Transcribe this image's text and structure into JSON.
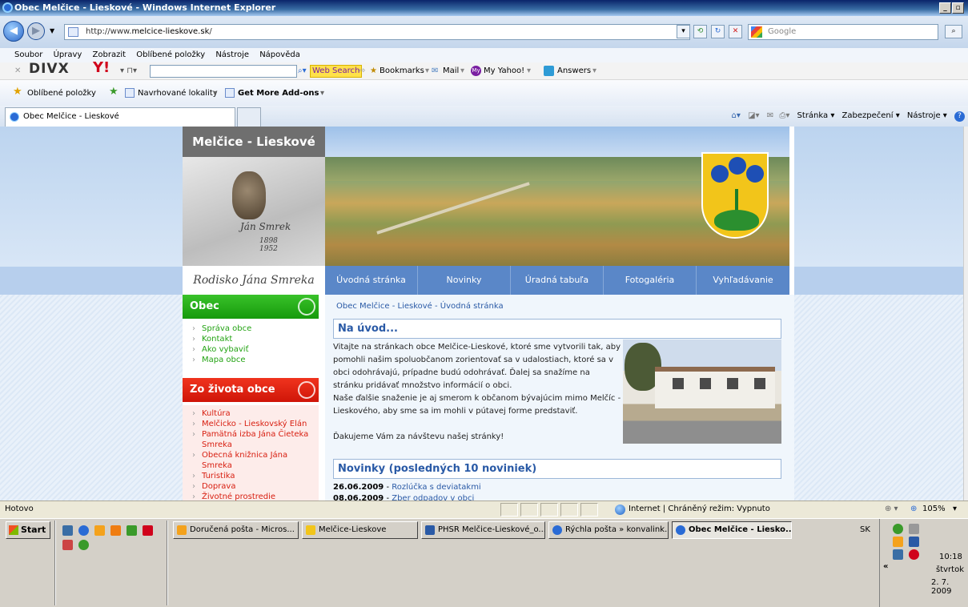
{
  "window": {
    "title": "Obec Melčice - Lieskové - Windows Internet Explorer"
  },
  "address": {
    "url_prefix": "http://www.",
    "url_domain": "melcice-lieskove.sk",
    "url_suffix": "/",
    "search_placeholder": "Google"
  },
  "menu": [
    "Soubor",
    "Úpravy",
    "Zobrazit",
    "Oblíbené položky",
    "Nástroje",
    "Nápověda"
  ],
  "toolbar1": {
    "divx": "DIVX",
    "web_search": "Web Search",
    "bookmarks": "Bookmarks",
    "mail": "Mail",
    "my_yahoo": "My Yahoo!",
    "answers": "Answers"
  },
  "toolbar2": {
    "favorites": "Oblíbené položky",
    "suggested": "Navrhované lokality",
    "addons": "Get More Add-ons"
  },
  "tab": {
    "label": "Obec Melčice - Lieskové"
  },
  "commands": {
    "page": "Stránka",
    "security": "Zabezpečení",
    "tools": "Nástroje"
  },
  "site": {
    "title": "Melčice - Lieskové",
    "signature": "Ján Smrek",
    "years": "1898\n1952",
    "rodisko": "Rodisko Jána Smreka",
    "nav": [
      "Úvodná stránka",
      "Novinky",
      "Úradná tabuľa",
      "Fotogaléria",
      "Vyhľadávanie"
    ],
    "section1": {
      "title": "Obec",
      "items": [
        "Správa obce",
        "Kontakt",
        "Ako vybaviť",
        "Mapa obce"
      ]
    },
    "section2": {
      "title": "Zo života obce",
      "items": [
        "Kultúra",
        "Melčicko - Lieskovský Elán",
        "Pamätná izba Jána Čieteka Smreka",
        "Obecná knižnica Jána Smreka",
        "Turistika",
        "Doprava",
        "Životné prostredie"
      ]
    },
    "breadcrumb": "Obec Melčice - Lieskové - Úvodná stránka",
    "intro_heading": "Na úvod...",
    "intro_p1": "Vitajte na stránkach obce Melčice-Lieskové, ktoré sme vytvorili tak, aby pomohli našim spoluobčanom zorientovať sa v udalostiach, ktoré sa v obci odohrávajú, prípadne budú odohrávať. Ďalej sa snažíme na stránku pridávať množstvo informácií o obci.",
    "intro_p2": "Naše ďalšie snaženie je aj smerom k občanom bývajúcim mimo Melčíc - Lieskového, aby sme sa im mohli v pútavej forme predstaviť.",
    "intro_p3": "Ďakujeme Vám za návštevu našej stránky!",
    "news_heading": "Novinky (posledných 10 noviniek)",
    "news": [
      {
        "date": "26.06.2009",
        "title": "Rozlúčka s deviatakmi"
      },
      {
        "date": "08.06.2009",
        "title": "Zber odpadov v obci"
      }
    ]
  },
  "status": {
    "text": "Hotovo",
    "zone": "Internet | Chráněný režim: Vypnuto",
    "zoom": "105%"
  },
  "taskbar": {
    "start": "Start",
    "tasks": [
      "Doručená pošta - Micros...",
      "Melčice-Lieskove",
      "PHSR Melčice-Lieskové_o...",
      "Rýchla pošta » konvalink...",
      "Obec Melčice - Liesko..."
    ],
    "lang": "SK",
    "time": "10:18",
    "day": "štvrtok",
    "date": "2. 7. 2009"
  },
  "colors": {
    "obec_green": "#23a313",
    "zivot_red": "#e01b0f",
    "nav_blue": "#5a87c8",
    "link_blue": "#2a5aa6"
  }
}
